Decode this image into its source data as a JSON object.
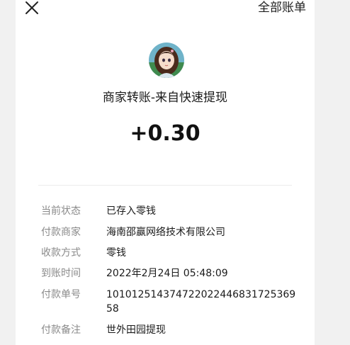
{
  "header": {
    "close_icon": "close-icon",
    "all_bills_label": "全部账单"
  },
  "merchant": {
    "avatar_icon": "anime-girl-avatar",
    "title": "商家转账-来自快速提现"
  },
  "amount": "+0.30",
  "details": [
    {
      "label": "当前状态",
      "value": "已存入零钱"
    },
    {
      "label": "付款商家",
      "value": "海南邵赢网络技术有限公司"
    },
    {
      "label": "收款方式",
      "value": "零钱"
    },
    {
      "label": "到账时间",
      "value": "2022年2月24日 05:48:09"
    },
    {
      "label": "付款单号",
      "value": "10101251437472202244683172536958"
    },
    {
      "label": "付款备注",
      "value": "世外田园提现"
    }
  ]
}
